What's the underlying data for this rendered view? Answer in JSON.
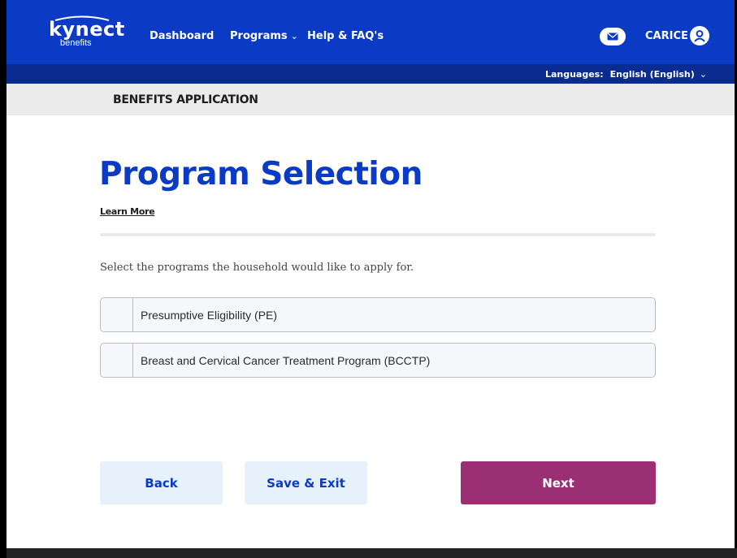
{
  "header": {
    "logo_text": "kynect",
    "logo_sub": "benefits",
    "nav": {
      "dashboard": "Dashboard",
      "programs": "Programs",
      "help": "Help & FAQ's"
    },
    "user_name": "CARICE"
  },
  "language_bar": {
    "label": "Languages:",
    "value": "English (English)"
  },
  "breadcrumb": {
    "title": "BENEFITS APPLICATION"
  },
  "main": {
    "title": "Program Selection",
    "learn_more": "Learn More",
    "instructions": "Select the programs the household would like to apply for.",
    "options": [
      {
        "label": "Presumptive Eligibility (PE)",
        "checked": false
      },
      {
        "label": "Breast and Cervical Cancer Treatment Program (BCCTP)",
        "checked": false
      }
    ]
  },
  "actions": {
    "back": "Back",
    "save_exit": "Save & Exit",
    "next": "Next"
  },
  "colors": {
    "brand_blue": "#0b3bc4",
    "lang_bar": "#0a2b8f",
    "next_button": "#9b2f73",
    "secondary_button": "#e6f1fb"
  },
  "icons": {
    "mail": "mail-icon",
    "user": "user-avatar-icon",
    "chevron": "chevron-down-icon"
  }
}
